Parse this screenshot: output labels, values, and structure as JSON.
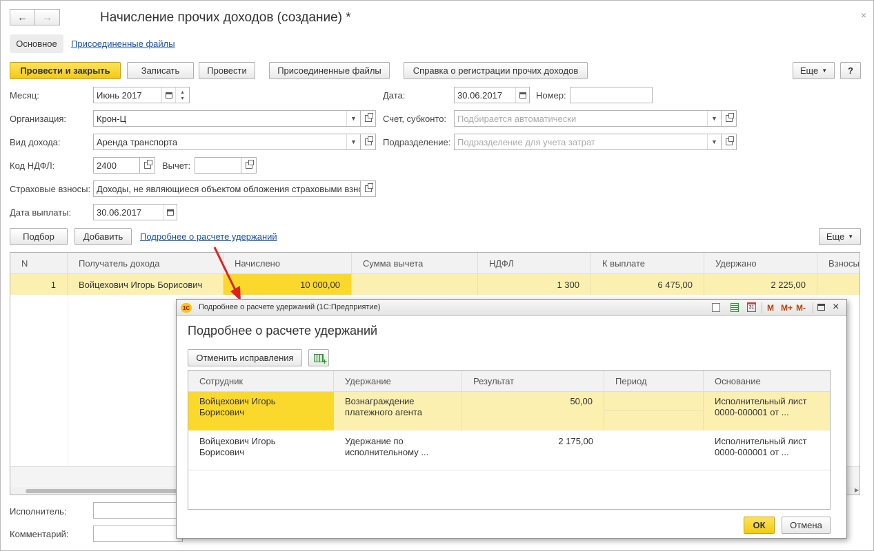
{
  "window": {
    "title": "Начисление прочих доходов (создание) *",
    "back_icon": "←",
    "forward_icon": "→",
    "close_icon": "×"
  },
  "tabs": {
    "main": "Основное",
    "files": "Присоединенные файлы"
  },
  "toolbar": {
    "post_close": "Провести и закрыть",
    "save": "Записать",
    "post": "Провести",
    "attached_files": "Присоединенные файлы",
    "report": "Справка о регистрации прочих доходов",
    "more": "Еще",
    "help": "?"
  },
  "form": {
    "month_label": "Месяц:",
    "month_value": "Июнь 2017",
    "date_label": "Дата:",
    "date_value": "30.06.2017",
    "number_label": "Номер:",
    "number_value": "",
    "org_label": "Организация:",
    "org_value": "Крон-Ц",
    "account_label": "Счет, субконто:",
    "account_placeholder": "Подбирается автоматически",
    "income_label": "Вид дохода:",
    "income_value": "Аренда транспорта",
    "dept_label": "Подразделение:",
    "dept_placeholder": "Подразделение для учета затрат",
    "ndfl_code_label": "Код НДФЛ:",
    "ndfl_code_value": "2400",
    "deduction_label": "Вычет:",
    "deduction_value": "",
    "insurance_label": "Страховые взносы:",
    "insurance_value": "Доходы, не являющиеся объектом обложения страховыми взно",
    "pay_date_label": "Дата выплаты:",
    "pay_date_value": "30.06.2017"
  },
  "table_toolbar": {
    "select": "Подбор",
    "add": "Добавить",
    "details_link": "Подробнее о расчете удержаний",
    "more": "Еще"
  },
  "table": {
    "columns": [
      "N",
      "Получатель дохода",
      "Начислено",
      "Сумма вычета",
      "НДФЛ",
      "К выплате",
      "Удержано",
      "Взносы"
    ],
    "rows": [
      {
        "n": "1",
        "recipient": "Войцехович Игорь Борисович",
        "accrued": "10 000,00",
        "deduction": "",
        "ndfl": "1 300",
        "to_pay": "6 475,00",
        "withheld": "2 225,00",
        "fees": ""
      }
    ]
  },
  "bottom": {
    "executor_label": "Исполнитель:",
    "comment_label": "Комментарий:"
  },
  "dialog": {
    "bar_title": "Подробнее о расчете удержаний  (1С:Предприятие)",
    "heading": "Подробнее о расчете удержаний",
    "cancel_fix": "Отменить исправления",
    "columns": [
      "Сотрудник",
      "Удержание",
      "Результат",
      "Период",
      "Основание"
    ],
    "rows": [
      {
        "employee": "Войцехович Игорь Борисович",
        "deduction": "Вознаграждение платежного агента",
        "result": "50,00",
        "period": "",
        "basis": "Исполнительный лист 0000-000001 от ..."
      },
      {
        "employee": "Войцехович Игорь Борисович",
        "deduction": "Удержание по исполнительному ...",
        "result": "2 175,00",
        "period": "",
        "basis": "Исполнительный лист 0000-000001 от ..."
      }
    ],
    "ok": "ОК",
    "cancel": "Отмена",
    "logo": "1С",
    "bar_m": "M",
    "bar_mplus": "M+",
    "bar_mminus": "M-"
  },
  "colors": {
    "accent_yellow": "#f3ca12",
    "selected_row": "#fbf0b0",
    "selected_cell": "#fad92c",
    "link": "#1a53a8",
    "arrow": "#e02020"
  }
}
